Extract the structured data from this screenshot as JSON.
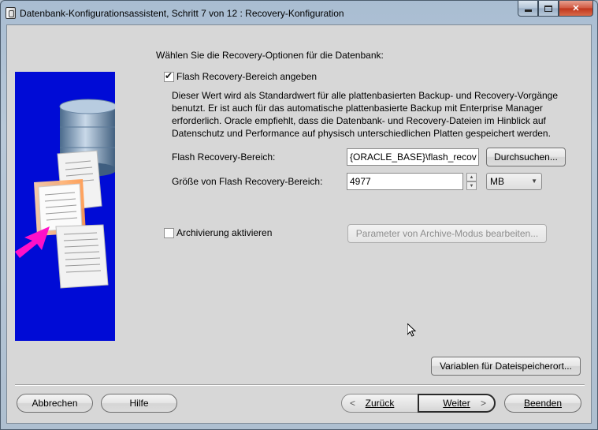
{
  "window": {
    "title": "Datenbank-Konfigurationsassistent, Schritt 7 von 12 : Recovery-Konfiguration",
    "icon": "db-config-app-icon"
  },
  "colors": {
    "illustration_bg": "#000bd6",
    "arrow_magenta": "#ff10c8",
    "client_bg": "#d7d7d7",
    "close_button": "#c0351c"
  },
  "content": {
    "prompt": "Wählen Sie die Recovery-Optionen für die Datenbank:",
    "flash_checkbox": {
      "label": "Flash Recovery-Bereich angeben",
      "checked": true
    },
    "description": "Dieser Wert wird als Standardwert für alle plattenbasierten Backup- und Recovery-Vorgänge benutzt. Er ist auch für das automatische plattenbasierte Backup mit Enterprise Manager erforderlich. Oracle empfiehlt, dass die Datenbank- und Recovery-Dateien im Hinblick auf Datenschutz und Performance auf physisch unterschiedlichen Platten gespeichert werden.",
    "flash_area": {
      "label": "Flash Recovery-Bereich:",
      "value": "{ORACLE_BASE}\\flash_recov",
      "browse_label": "Durchsuchen..."
    },
    "flash_size": {
      "label": "Größe von Flash Recovery-Bereich:",
      "value": "4977",
      "unit": "MB"
    },
    "archive_checkbox": {
      "label": "Archivierung aktivieren",
      "checked": false
    },
    "archive_params_label": "Parameter von Archive-Modus bearbeiten...",
    "variables_label": "Variablen für Dateispeicherort..."
  },
  "footer": {
    "cancel": "Abbrechen",
    "help": "Hilfe",
    "back": "Zurück",
    "next": "Weiter",
    "finish": "Beenden"
  }
}
